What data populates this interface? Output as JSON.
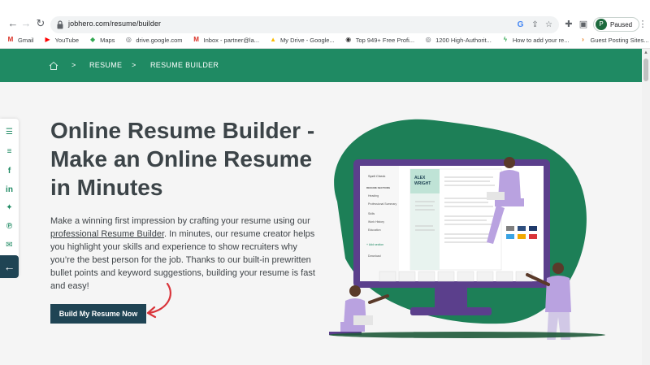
{
  "browser": {
    "url": "jobhero.com/resume/builder",
    "profile_initial": "P",
    "profile_status": "Paused"
  },
  "bookmarks": [
    {
      "label": "Gmail",
      "icon": "gmail-icon",
      "color": "#d93025",
      "glyph": "M"
    },
    {
      "label": "YouTube",
      "icon": "youtube-icon",
      "color": "#ff0000",
      "glyph": "▶"
    },
    {
      "label": "Maps",
      "icon": "maps-icon",
      "color": "#34a853",
      "glyph": "◆"
    },
    {
      "label": "drive.google.com",
      "icon": "globe-icon",
      "color": "#5f6368",
      "glyph": "◎"
    },
    {
      "label": "Inbox - partner@la...",
      "icon": "gmail-icon",
      "color": "#d93025",
      "glyph": "M"
    },
    {
      "label": "My Drive - Google...",
      "icon": "drive-icon",
      "color": "#fbbc04",
      "glyph": "▲"
    },
    {
      "label": "Top 949+ Free Profi...",
      "icon": "site-icon",
      "color": "#333333",
      "glyph": "◉"
    },
    {
      "label": "1200 High-Authorit...",
      "icon": "globe-icon",
      "color": "#5f6368",
      "glyph": "◎"
    },
    {
      "label": "How to add your re...",
      "icon": "bolt-icon",
      "color": "#34a853",
      "glyph": "ϟ"
    },
    {
      "label": "Guest Posting Sites...",
      "icon": "chevron-icon",
      "color": "#e8710a",
      "glyph": "›"
    }
  ],
  "breadcrumb": {
    "items": [
      "RESUME",
      "RESUME BUILDER"
    ],
    "separator": ">"
  },
  "hero": {
    "title": "Online Resume Builder - Make an Online Resume in Minutes",
    "desc_before": "Make a winning first impression by crafting your resume using our ",
    "desc_link": "professional Resume Builder",
    "desc_after": ". In minutes, our resume creator helps you highlight your skills and experience to show recruiters why you’re the best person for the job. Thanks to our built-in prewritten bullet points and keyword suggestions, building your resume is fast and easy!",
    "cta_label": "Build My Resume Now"
  },
  "illustration": {
    "resume_name_first": "ALEX",
    "resume_name_last": "WRIGHT",
    "spell_check": "Spell Check",
    "sections_heading": "RESUME SECTIONS",
    "sections": [
      "Heading",
      "Professional Summary",
      "Skills",
      "Work History",
      "Education"
    ],
    "add_section": "+ Add section",
    "download": "Download"
  },
  "colors": {
    "brand_green": "#1f8a63",
    "navy": "#1f4454",
    "purple": "#5b3f8c",
    "lavender": "#b9a2e0",
    "teal_blob": "#1d7f57"
  }
}
